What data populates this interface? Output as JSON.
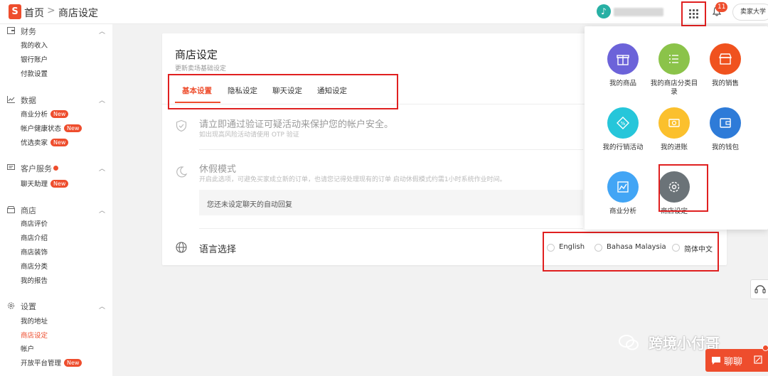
{
  "header": {
    "logo_letter": "S",
    "breadcrumb_home": "首页",
    "breadcrumb_sep": ">",
    "breadcrumb_current": "商店设定",
    "notification_count": "11",
    "seller_university": "卖家大学"
  },
  "sidebar": {
    "new_badge": "New",
    "sections": [
      {
        "title": "财务",
        "items": [
          "我的收入",
          "银行账户",
          "付款设置"
        ]
      },
      {
        "title": "数据",
        "items": [
          "商业分析",
          "帐户健康状态",
          "优选卖家"
        ]
      },
      {
        "title": "客户服务",
        "items": [
          "聊天助理"
        ]
      },
      {
        "title": "商店",
        "items": [
          "商店评价",
          "商店介绍",
          "商店装饰",
          "商店分类",
          "我的报告"
        ]
      },
      {
        "title": "设置",
        "items": [
          "我的地址",
          "商店设定",
          "帐户",
          "开放平台管理"
        ]
      }
    ]
  },
  "main": {
    "title": "商店设定",
    "subtitle": "更新卖场基础设定",
    "tabs": [
      "基本设置",
      "隐私设定",
      "聊天设定",
      "通知设定"
    ],
    "security_title": "请立即通过验证可疑活动来保护您的帐户安全。",
    "security_sub": "如出现高风险活动请使用 OTP 验证",
    "vacation_title": "休假模式",
    "vacation_sub": "开启此选项，可避免买家成立新的订单，也请您记得处理现有的订单 启动休假模式约需1小时系统作业时间。",
    "auto_reply_text": "您还未设定聊天的自动回复",
    "language_title": "语言选择",
    "languages": [
      "English",
      "Bahasa Malaysia",
      "简体中文"
    ]
  },
  "app_menu": {
    "apps": [
      {
        "label": "我的商品",
        "color": "#6c63d9"
      },
      {
        "label": "我的商店分类目录",
        "color": "#8bc34a"
      },
      {
        "label": "我的销售",
        "color": "#f0521e"
      },
      {
        "label": "我的行销活动",
        "color": "#26c6da"
      },
      {
        "label": "我的进账",
        "color": "#fbc02d"
      },
      {
        "label": "我的钱包",
        "color": "#2e7bd8"
      },
      {
        "label": "商业分析",
        "color": "#42a5f5"
      },
      {
        "label": "商店设定",
        "color": "#6b7378"
      }
    ]
  },
  "watermark": "跨境小付哥",
  "chat_label": "聊聊"
}
